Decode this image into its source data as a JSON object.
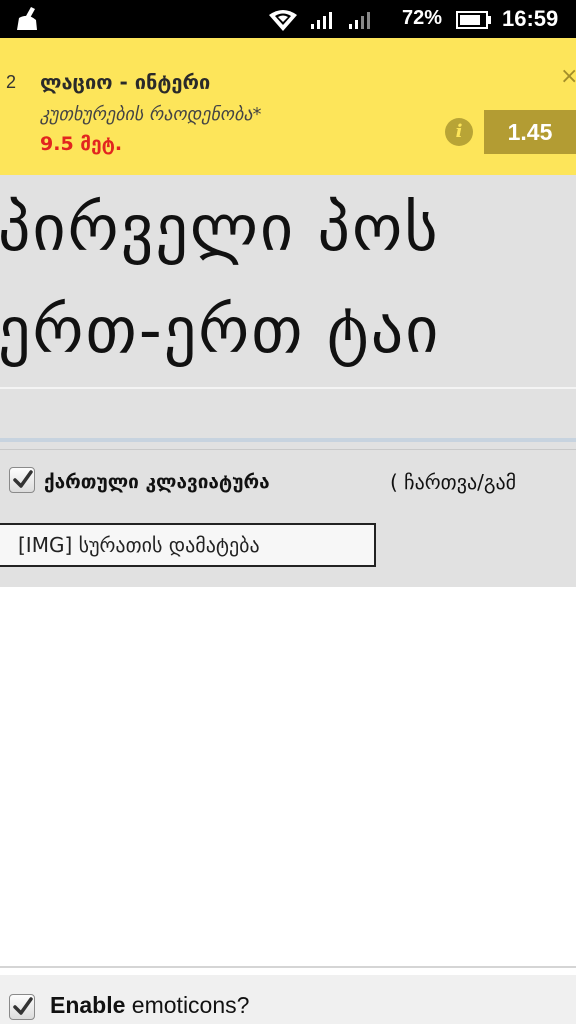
{
  "status_bar": {
    "battery_percent": "72%",
    "time": "16:59",
    "icons": [
      "cleaner-broom-icon",
      "wifi-icon",
      "signal-icon",
      "signal-icon",
      "battery-icon"
    ]
  },
  "ad": {
    "rank": "2",
    "title": "ლაციო - ინტერი",
    "subtitle": "კუთხურების რაოდენობა*",
    "threshold": "9.5 მეტ.",
    "odds": "1.45",
    "close_label": "×",
    "info_label": "i",
    "colors": {
      "background": "#fde55a",
      "odds_bg": "#b39c33",
      "threshold_text": "#e2251f"
    }
  },
  "heading": {
    "line1": "პირველი პოს",
    "line2": "ერთ-ერთ ტაი"
  },
  "keyboard": {
    "checked": true,
    "label": "ქართული კლავიატურა",
    "toggle_text": "( ჩართვა/გამ"
  },
  "image_button": {
    "label": "[IMG] სურათის დამატება"
  },
  "emoticons": {
    "checked": true,
    "label_bold": "Enable",
    "label_rest": " emoticons?"
  }
}
